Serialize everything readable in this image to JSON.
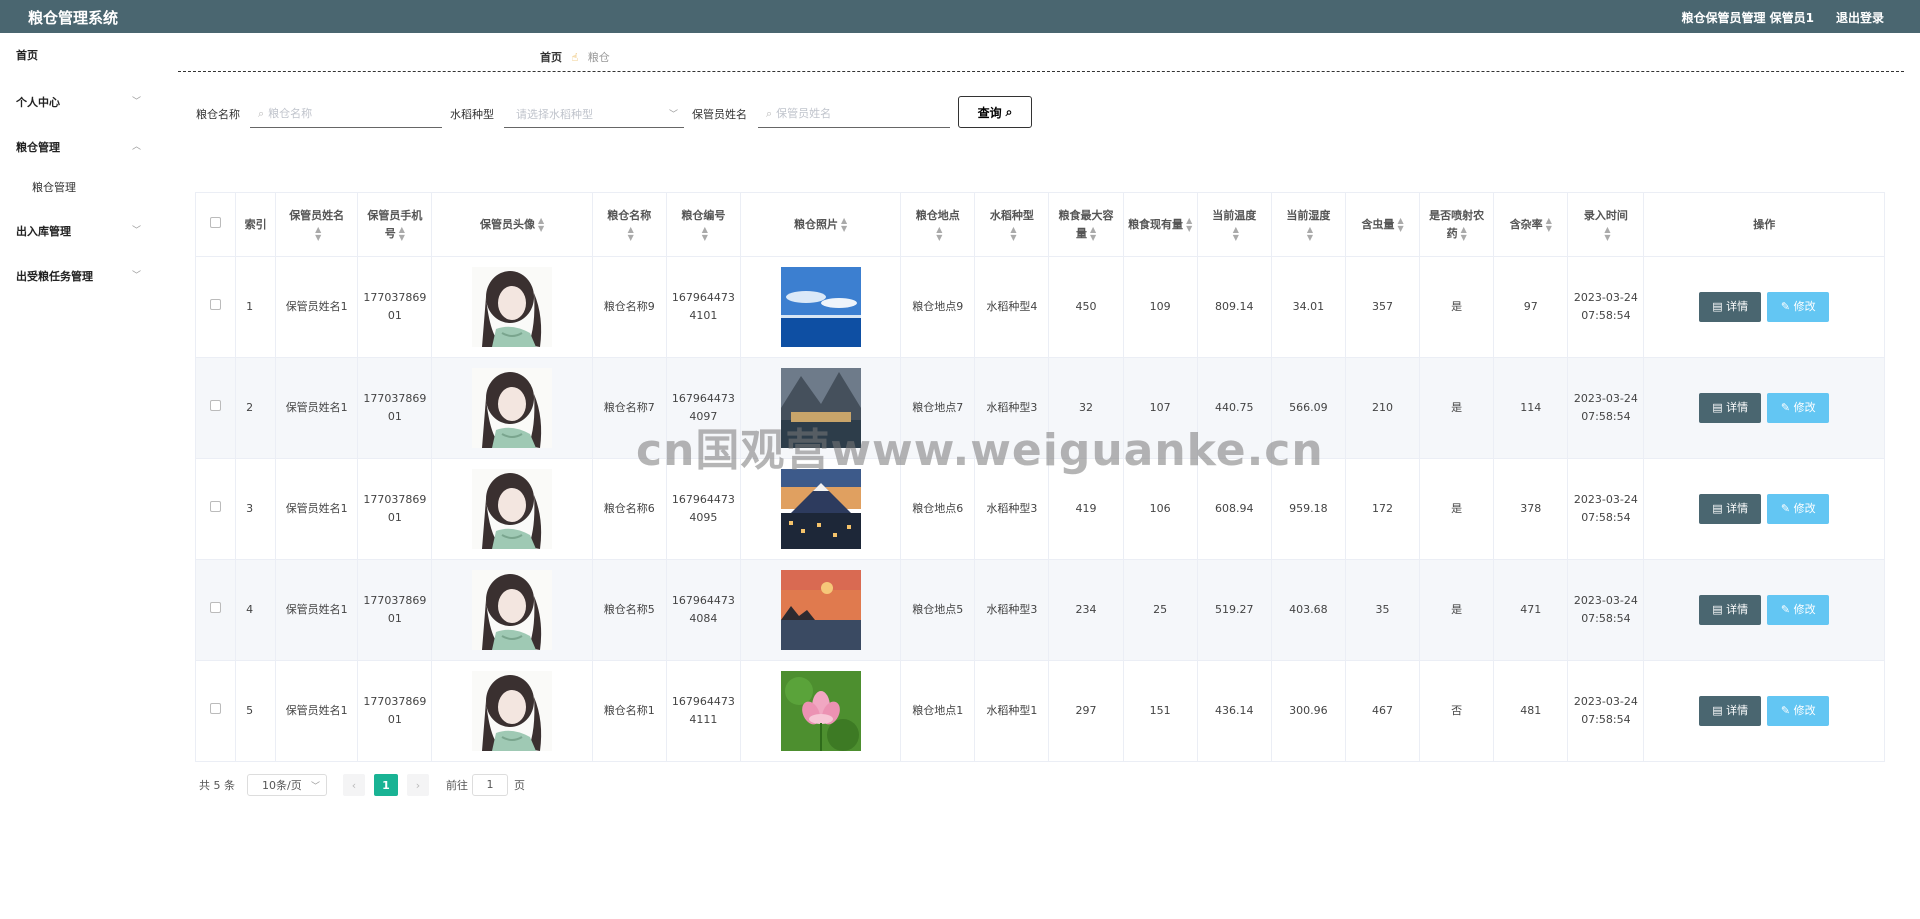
{
  "header": {
    "app_title": "粮仓管理系统",
    "user_info": "粮仓保管员管理 保管员1",
    "logout": "退出登录"
  },
  "sidebar": {
    "items": [
      {
        "label": "首页",
        "expandable": false
      },
      {
        "label": "个人中心",
        "expandable": true,
        "expanded": false
      },
      {
        "label": "粮仓管理",
        "expandable": true,
        "expanded": true
      },
      {
        "label": "出入库管理",
        "expandable": true,
        "expanded": false
      },
      {
        "label": "出受粮任务管理",
        "expandable": true,
        "expanded": false
      }
    ],
    "subitems": [
      {
        "label": "粮仓管理"
      }
    ]
  },
  "breadcrumb": {
    "home": "首页",
    "current": "粮仓",
    "icon": "hand-icon"
  },
  "search": {
    "name_label": "粮仓名称",
    "name_placeholder": "粮仓名称",
    "type_label": "水稻种型",
    "type_placeholder": "请选择水稻种型",
    "keeper_label": "保管员姓名",
    "keeper_placeholder": "保管员姓名",
    "query_button": "查询"
  },
  "table": {
    "columns": [
      "索引",
      "保管员姓名",
      "保管员手机号",
      "保管员头像",
      "粮仓名称",
      "粮仓编号",
      "粮仓照片",
      "粮仓地点",
      "水稻种型",
      "粮食最大容量",
      "粮食现有量",
      "当前温度",
      "当前湿度",
      "含虫量",
      "是否喷射农药",
      "含杂率",
      "录入时间",
      "操作"
    ],
    "rows": [
      {
        "index": "1",
        "keeper": "保管员姓名1",
        "phone": "17703786901",
        "name": "粮仓名称9",
        "code": "1679644734101",
        "photo": "ocean-sky",
        "location": "粮仓地点9",
        "type": "水稻种型4",
        "max": "450",
        "current": "109",
        "temp": "809.14",
        "humidity": "34.01",
        "insect": "357",
        "pesticide": "是",
        "impurity": "97",
        "time": "2023-03-24 07:58:54"
      },
      {
        "index": "2",
        "keeper": "保管员姓名1",
        "phone": "17703786901",
        "name": "粮仓名称7",
        "code": "1679644734097",
        "photo": "mountain-lake",
        "location": "粮仓地点7",
        "type": "水稻种型3",
        "max": "32",
        "current": "107",
        "temp": "440.75",
        "humidity": "566.09",
        "insect": "210",
        "pesticide": "是",
        "impurity": "114",
        "time": "2023-03-24 07:58:54"
      },
      {
        "index": "3",
        "keeper": "保管员姓名1",
        "phone": "17703786901",
        "name": "粮仓名称6",
        "code": "1679644734095",
        "photo": "mountain-city",
        "location": "粮仓地点6",
        "type": "水稻种型3",
        "max": "419",
        "current": "106",
        "temp": "608.94",
        "humidity": "959.18",
        "insect": "172",
        "pesticide": "是",
        "impurity": "378",
        "time": "2023-03-24 07:58:54"
      },
      {
        "index": "4",
        "keeper": "保管员姓名1",
        "phone": "17703786901",
        "name": "粮仓名称5",
        "code": "1679644734084",
        "photo": "sunset-moon",
        "location": "粮仓地点5",
        "type": "水稻种型3",
        "max": "234",
        "current": "25",
        "temp": "519.27",
        "humidity": "403.68",
        "insect": "35",
        "pesticide": "是",
        "impurity": "471",
        "time": "2023-03-24 07:58:54"
      },
      {
        "index": "5",
        "keeper": "保管员姓名1",
        "phone": "17703786901",
        "name": "粮仓名称1",
        "code": "1679644734111",
        "photo": "lotus-flower",
        "location": "粮仓地点1",
        "type": "水稻种型1",
        "max": "297",
        "current": "151",
        "temp": "436.14",
        "humidity": "300.96",
        "insect": "467",
        "pesticide": "否",
        "impurity": "481",
        "time": "2023-03-24 07:58:54"
      }
    ],
    "detail_button": "详情",
    "edit_button": "修改"
  },
  "pagination": {
    "total": "共 5 条",
    "page_size": "10条/页",
    "current_page": "1",
    "goto_prefix": "前往",
    "goto_value": "1",
    "goto_suffix": "页"
  },
  "watermark": "cn国观营www.weiguanke.cn",
  "colors": {
    "header_bg": "#4a6670",
    "detail_btn": "#4a6670",
    "edit_btn": "#63c6f3",
    "active_page": "#19b394"
  }
}
